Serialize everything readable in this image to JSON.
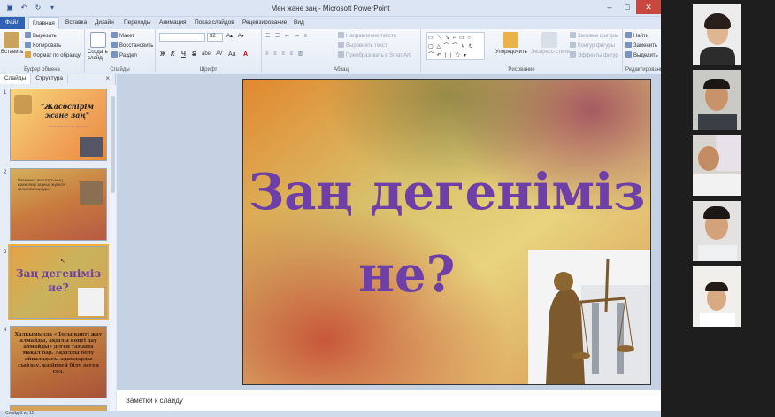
{
  "window": {
    "title": "Мен және заң - Microsoft PowerPoint",
    "minimize": "–",
    "maximize": "□",
    "close": "✕"
  },
  "tabs": [
    "Файл",
    "Главная",
    "Вставка",
    "Дизайн",
    "Переходы",
    "Анимация",
    "Показ слайдов",
    "Рецензирование",
    "Вид"
  ],
  "ribbon": {
    "clipboard": {
      "label": "Буфер обмена",
      "paste": "Вставить",
      "cut": "Вырезать",
      "copy": "Копировать",
      "format_painter": "Формат по образцу"
    },
    "slides": {
      "label": "Слайды",
      "new_slide": "Создать слайд",
      "layout": "Макет",
      "reset": "Восстановить",
      "section": "Раздел"
    },
    "font": {
      "label": "Шрифт",
      "size": "32",
      "bold": "Ж",
      "italic": "К",
      "underline": "Ч",
      "strike": "S",
      "shadow": "abe",
      "spacing": "AV",
      "case": "Aa",
      "color": "A"
    },
    "paragraph": {
      "label": "Абзац",
      "text_direction": "Направление текста",
      "align_text": "Выровнять текст",
      "smartart": "Преобразовать в SmartArt"
    },
    "drawing": {
      "label": "Рисование",
      "arrange": "Упорядочить",
      "quick_styles": "Экспресс-стили",
      "fill": "Заливка фигуры",
      "outline": "Контур фигуры",
      "effects": "Эффекты фигур"
    },
    "editing": {
      "label": "Редактирование",
      "find": "Найти",
      "replace": "Заменить",
      "select": "Выделить"
    }
  },
  "sidebar": {
    "tabs": [
      "Слайды",
      "Структура"
    ],
    "close": "×",
    "thumbnails": [
      {
        "num": "1",
        "title": "\"Жасөспірім және заң\"",
        "subtitle": "Жасөспірім және заң тақырыбы"
      },
      {
        "num": "2",
        "text": "Мемлекет институтының ережелері заңның жүйесін қалыптастырады."
      },
      {
        "num": "3",
        "title": "Заң дегеніміз не?"
      },
      {
        "num": "4",
        "text": "Халқымызда «Досы көпті жау алмайды, ақылы көпті дау алмайды» деген тамаша мақал бар. Ақылды болу айналадағы адамдарды сыйлау, қадірлей білу деген сөз."
      }
    ]
  },
  "slide": {
    "title_line1": "Заң дегеніміз",
    "title_line2": "не?"
  },
  "notes": {
    "placeholder": "Заметки к слайду"
  },
  "status": {
    "text": "Слайд 3 из 11"
  },
  "colors": {
    "accent": "#2f62b3",
    "title_purple": "#6e3fa6"
  }
}
